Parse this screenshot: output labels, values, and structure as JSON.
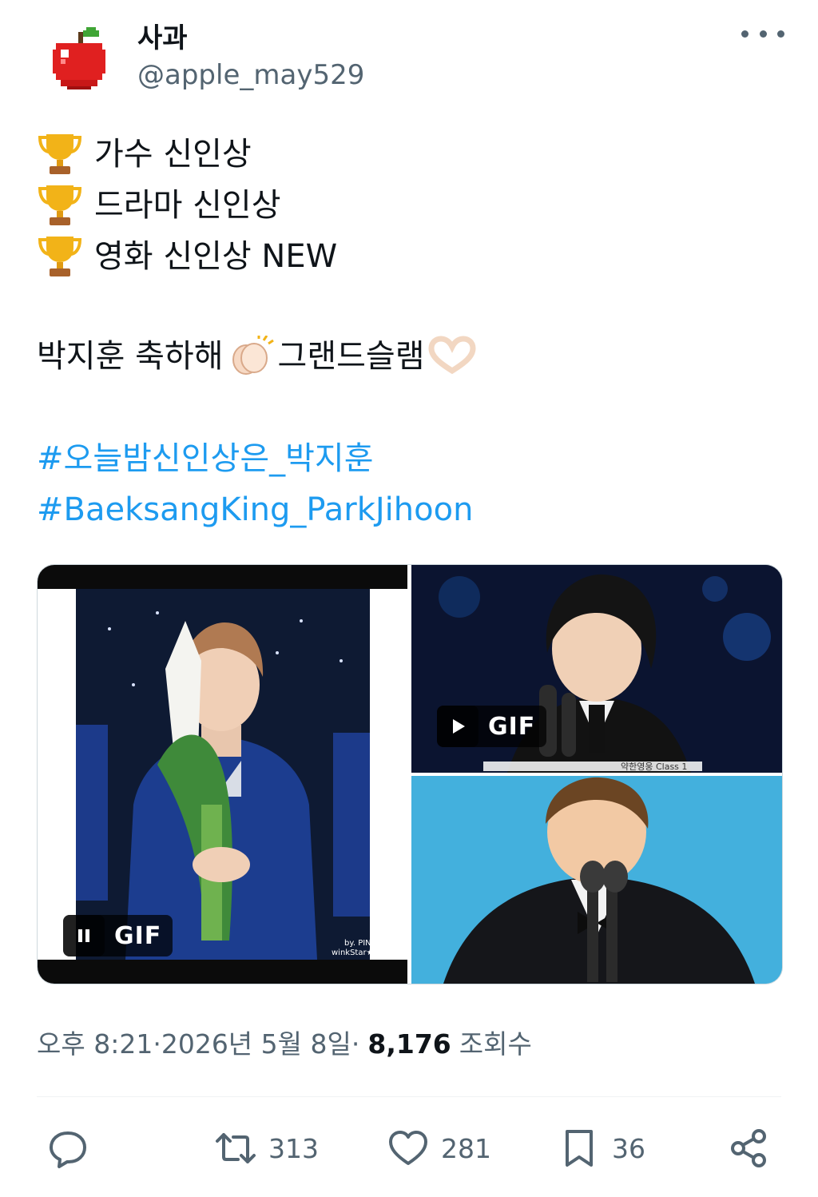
{
  "author": {
    "display_name": "사과",
    "handle": "@apple_may529",
    "avatar_icon": "red-apple-pixel-icon"
  },
  "tweet": {
    "lines": [
      {
        "icon": "trophy-icon",
        "text": "가수 신인상"
      },
      {
        "icon": "trophy-icon",
        "text": "드라마 신인상"
      },
      {
        "icon": "trophy-icon",
        "text": "영화 신인상 NEW"
      }
    ],
    "congrats": {
      "part1": "박지훈 축하해",
      "emoji1": "clapping-hands-icon",
      "part2": " 그랜드슬램",
      "emoji2": "heart-hands-icon"
    },
    "hashtags": [
      "#오늘밤신인상은_박지훈",
      "#BaeksangKing_ParkJihoon"
    ]
  },
  "media": {
    "items": [
      {
        "type": "gif",
        "badge": "GIF",
        "state": "playing",
        "control_icon": "pause-icon",
        "watermark": [
          "by. PINK TAPE",
          "winkStar★"
        ]
      },
      {
        "type": "gif",
        "badge": "GIF",
        "state": "paused",
        "control_icon": "play-icon",
        "caption": "약한영웅 Class 1"
      },
      {
        "type": "image"
      }
    ]
  },
  "meta": {
    "time": "오후 8:21",
    "separator": " · ",
    "date": "2026년 5월 8일",
    "views_count": "8,176",
    "views_label": "조회수"
  },
  "actions": {
    "reply": {
      "icon": "reply-icon",
      "count": ""
    },
    "retweet": {
      "icon": "retweet-icon",
      "count": "313"
    },
    "like": {
      "icon": "heart-icon",
      "count": "281"
    },
    "bookmark": {
      "icon": "bookmark-icon",
      "count": "36"
    },
    "share": {
      "icon": "share-icon"
    }
  },
  "colors": {
    "hashtag": "#1d9bf0",
    "secondary_text": "#536471",
    "primary_text": "#0f1419"
  }
}
